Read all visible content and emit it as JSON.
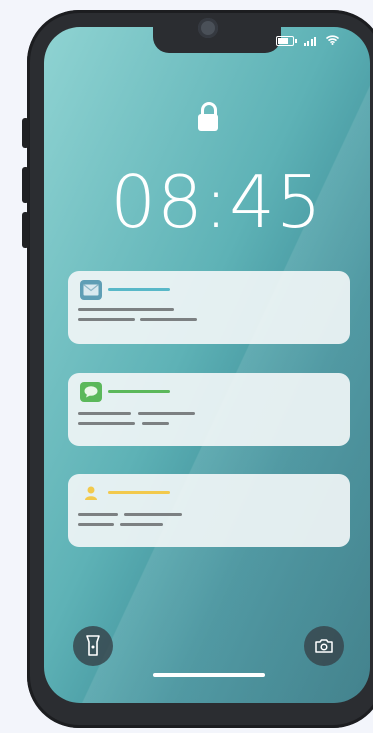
{
  "lockscreen": {
    "time": "08:45"
  },
  "notifications": [
    {
      "app": "mail",
      "icon": "envelope-icon",
      "accent": "#58b8c8"
    },
    {
      "app": "messages",
      "icon": "chat-bubble-icon",
      "accent": "#5bb85b"
    },
    {
      "app": "contacts",
      "icon": "person-icon",
      "accent": "#f2c94c"
    }
  ],
  "quick_actions": {
    "left_icon": "flashlight-icon",
    "right_icon": "camera-icon"
  },
  "colors": {
    "screen_gradient_start": "#8fd3d2",
    "screen_gradient_end": "#2e7480",
    "phone_frame": "#2b2d31"
  }
}
